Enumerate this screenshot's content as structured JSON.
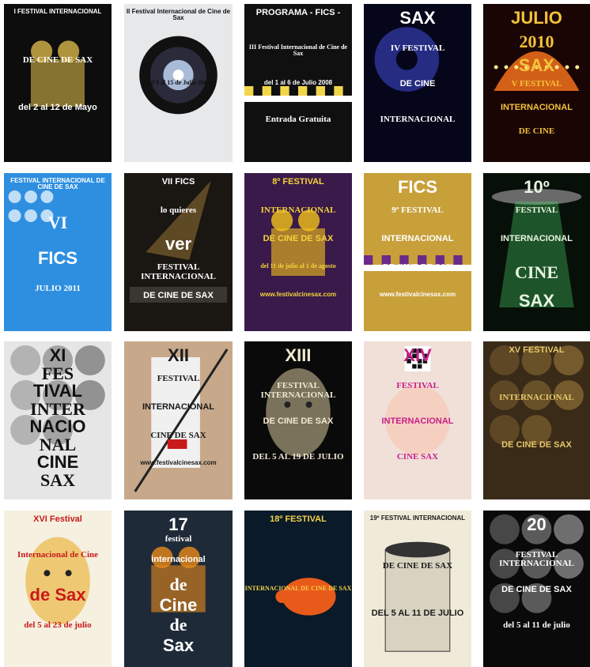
{
  "posters": [
    {
      "edition": "I",
      "lines": [
        "I FESTIVAL INTERNACIONAL",
        "DE CINE DE SAX",
        "del 2 al 12 de Mayo"
      ],
      "colors": {
        "bg": "#0d0d0d",
        "accent": "#d9b74a",
        "text": "#ffffff"
      },
      "motif": "film-camera-icon"
    },
    {
      "edition": "II",
      "lines": [
        "II Festival Internacional de Cine de Sax",
        "del 9 al 15 de Julio 2007"
      ],
      "colors": {
        "bg": "#e6e8ea",
        "accent": "#1a1a1a",
        "text": "#111111"
      },
      "motif": "lens-icon"
    },
    {
      "edition": "III",
      "lines": [
        "PROGRAMA - FICS -",
        "III Festival Internacional de Cine de Sax",
        "del 1 al 6 de Julio 2008",
        "Entrada Gratuita"
      ],
      "colors": {
        "bg": "#101010",
        "accent": "#f2d64a",
        "text": "#ffffff"
      },
      "motif": "clapperboard-icon"
    },
    {
      "edition": "IV",
      "lines": [
        "SAX",
        "IV FESTIVAL",
        "DE CINE",
        "INTERNACIONAL"
      ],
      "colors": {
        "bg": "#06061a",
        "accent": "#3a46c8",
        "text": "#ffffff"
      },
      "motif": "film-reel-icon"
    },
    {
      "edition": "V",
      "lines": [
        "JULIO",
        "2010",
        "SAX",
        "V FESTIVAL",
        "INTERNACIONAL",
        "DE CINE"
      ],
      "colors": {
        "bg": "#1a0505",
        "accent": "#e86a1a",
        "text": "#f3c23a"
      },
      "motif": "marquee-icon"
    },
    {
      "edition": "VI",
      "lines": [
        "FESTIVAL INTERNACIONAL DE CINE DE SAX",
        "VI",
        "FICS",
        "JULIO 2011"
      ],
      "colors": {
        "bg": "#2e8fe0",
        "accent": "#9fd4ff",
        "text": "#ffffff"
      },
      "motif": "flower-icon"
    },
    {
      "edition": "VII",
      "lines": [
        "VII FICS",
        "lo quieres",
        "ver",
        "FESTIVAL INTERNACIONAL",
        "DE CINE DE SAX"
      ],
      "colors": {
        "bg": "#1a1612",
        "accent": "#e0a94a",
        "text": "#ffffff"
      },
      "motif": "spotlight-icon"
    },
    {
      "edition": "8",
      "lines": [
        "8º FESTIVAL",
        "INTERNACIONAL",
        "DE CINE DE SAX",
        "del 11 de julio al 1 de agosto",
        "www.festivalcinesax.com"
      ],
      "colors": {
        "bg": "#3a1a4a",
        "accent": "#f3c21a",
        "text": "#f3d23a"
      },
      "motif": "film-camera-icon"
    },
    {
      "edition": "9",
      "lines": [
        "FICS",
        "9º FESTIVAL",
        "INTERNACIONAL",
        "DE CINE DE SAX",
        "www.festivalcinesax.com"
      ],
      "colors": {
        "bg": "#c8a03a",
        "accent": "#6a2a8a",
        "text": "#ffffff"
      },
      "motif": "clapperboard-icon"
    },
    {
      "edition": "10",
      "lines": [
        "10º",
        "FESTIVAL",
        "INTERNACIONAL",
        "CINE",
        "SAX"
      ],
      "colors": {
        "bg": "#061008",
        "accent": "#4ed36a",
        "text": "#e8f5e0"
      },
      "motif": "ufo-icon"
    },
    {
      "edition": "XI",
      "lines": [
        "XI",
        "FES",
        "TIVAL",
        "INTER",
        "NACIO",
        "NAL",
        "CINE",
        "SAX"
      ],
      "colors": {
        "bg": "#e6e6e6",
        "accent": "#1a1a1a",
        "text": "#111111"
      },
      "motif": "faces-icon"
    },
    {
      "edition": "XII",
      "lines": [
        "XII",
        "FESTIVAL",
        "INTERNACIONAL",
        "CINE DE SAX",
        "www.festivalcinesax.com"
      ],
      "colors": {
        "bg": "#c8a88a",
        "accent": "#c81a1a",
        "text": "#1a1a1a"
      },
      "motif": "katana-icon"
    },
    {
      "edition": "XIII",
      "lines": [
        "XIII",
        "FESTIVAL INTERNACIONAL",
        "DE CINE DE SAX",
        "DEL 5 AL 19 DE JULIO"
      ],
      "colors": {
        "bg": "#0a0a0a",
        "accent": "#d8c8a0",
        "text": "#f0e8d0"
      },
      "motif": "portrait-icon"
    },
    {
      "edition": "XIV",
      "lines": [
        "XIV",
        "FESTIVAL",
        "INTERNACIONAL",
        "CINE SAX"
      ],
      "colors": {
        "bg": "#f0e0d8",
        "accent": "#e84a8a",
        "text": "#c8208a"
      },
      "motif": "qr-code-icon"
    },
    {
      "edition": "XV",
      "lines": [
        "XV FESTIVAL",
        "INTERNACIONAL",
        "DE CINE DE SAX"
      ],
      "colors": {
        "bg": "#3a2a18",
        "accent": "#c8a04a",
        "text": "#e8c86a"
      },
      "motif": "collage-icon"
    },
    {
      "edition": "XVI",
      "lines": [
        "XVI Festival",
        "Internacional de Cine",
        "de Sax",
        "del 5 al 23 de julio"
      ],
      "colors": {
        "bg": "#f5f0e0",
        "accent": "#e8a81a",
        "text": "#c81a1a"
      },
      "motif": "portrait-icon"
    },
    {
      "edition": "17",
      "lines": [
        "17",
        "festival",
        "internacional",
        "de",
        "Cine",
        "de",
        "Sax"
      ],
      "colors": {
        "bg": "#1e2a38",
        "accent": "#e88a1a",
        "text": "#ffffff"
      },
      "motif": "film-camera-icon"
    },
    {
      "edition": "18",
      "lines": [
        "18º FESTIVAL",
        "INTERNACIONAL DE CINE DE SAX"
      ],
      "colors": {
        "bg": "#0a1a28",
        "accent": "#e85a1a",
        "text": "#f3d24a"
      },
      "motif": "turtle-icon"
    },
    {
      "edition": "19",
      "lines": [
        "19º FESTIVAL INTERNACIONAL",
        "DE CINE DE SAX",
        "DEL 5 AL 11 DE JULIO"
      ],
      "colors": {
        "bg": "#f0ead8",
        "accent": "#3a3a3a",
        "text": "#1a1a1a"
      },
      "motif": "tower-icon"
    },
    {
      "edition": "20",
      "lines": [
        "20",
        "FESTIVAL INTERNACIONAL",
        "DE CINE DE SAX",
        "del 5 al 11 de julio"
      ],
      "colors": {
        "bg": "#0a0a0a",
        "accent": "#ffffff",
        "text": "#ffffff"
      },
      "motif": "collage-icon"
    }
  ]
}
